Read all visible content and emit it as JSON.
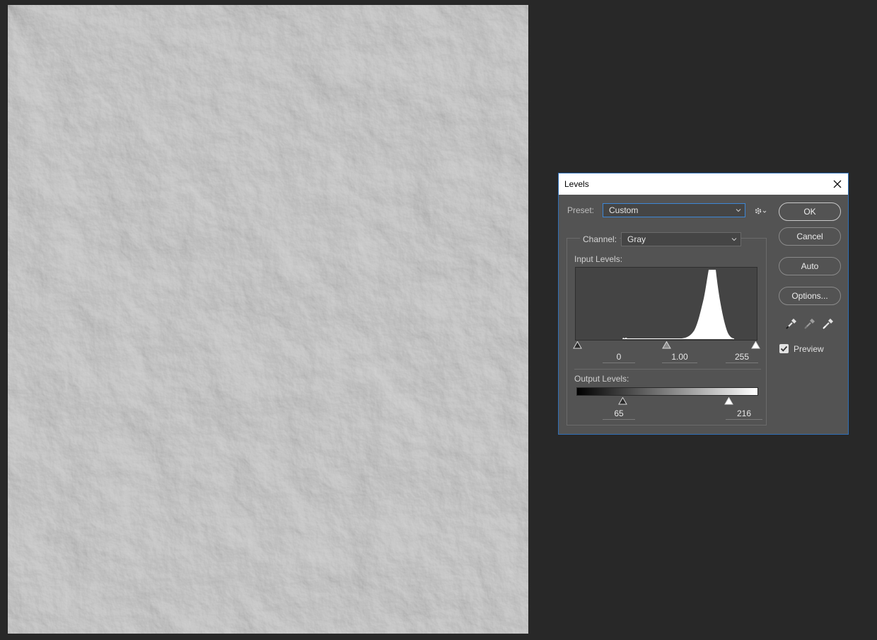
{
  "dialog": {
    "title": "Levels",
    "preset_label": "Preset:",
    "preset_value": "Custom",
    "channel_label": "Channel:",
    "channel_value": "Gray",
    "input_levels_label": "Input Levels:",
    "input_black": "0",
    "input_gamma": "1.00",
    "input_white": "255",
    "output_levels_label": "Output Levels:",
    "output_black": "65",
    "output_white": "216",
    "preview_label": "Preview",
    "preview_checked": true
  },
  "buttons": {
    "ok": "OK",
    "cancel": "Cancel",
    "auto": "Auto",
    "options": "Options..."
  },
  "icons": {
    "close": "close-icon",
    "gear": "gear-icon",
    "dropdown": "chevron-down-icon",
    "black_eyedropper": "black-point-eyedropper-icon",
    "gray_eyedropper": "gray-point-eyedropper-icon",
    "white_eyedropper": "white-point-eyedropper-icon"
  },
  "colors": {
    "app_background": "#282828",
    "canvas": "#c9c9c9",
    "dialog_bg": "#535353",
    "accent": "#3d87d6"
  }
}
